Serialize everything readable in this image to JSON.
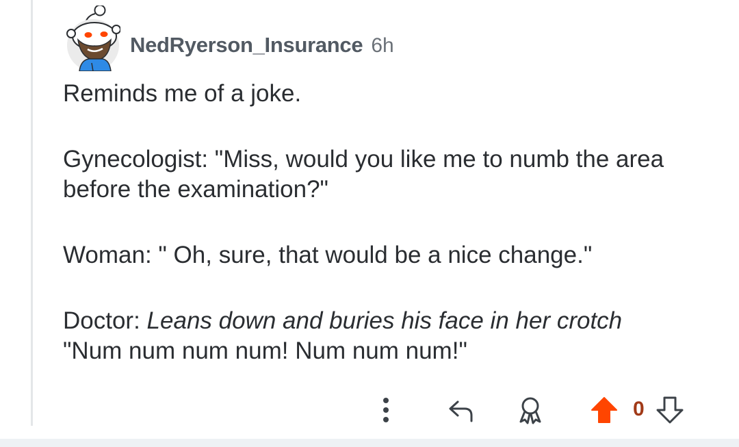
{
  "comment": {
    "author": "NedRyerson_Insurance",
    "age": "6h",
    "paragraph_1": "Reminds me of a joke.",
    "paragraph_2": "Gynecologist: \"Miss, would you like me to numb the area before the examination?\"",
    "paragraph_3": "Woman: \" Oh, sure, that would be a nice change.\"",
    "paragraph_4_prefix": "Doctor: ",
    "paragraph_4_italic": "Leans down and buries his face in her crotch",
    "paragraph_4_line2": "\"Num num num num! Num num num!\""
  },
  "actions": {
    "vote_count": "0",
    "upvote_color": "#ff4500",
    "icons": [
      "more-options-icon",
      "reply-icon",
      "award-icon",
      "upvote-icon",
      "downvote-icon"
    ]
  },
  "colors": {
    "text": "#2a2d31",
    "username": "#525a63",
    "timestamp": "#6b7178",
    "thread_line": "#e4e6e8"
  }
}
